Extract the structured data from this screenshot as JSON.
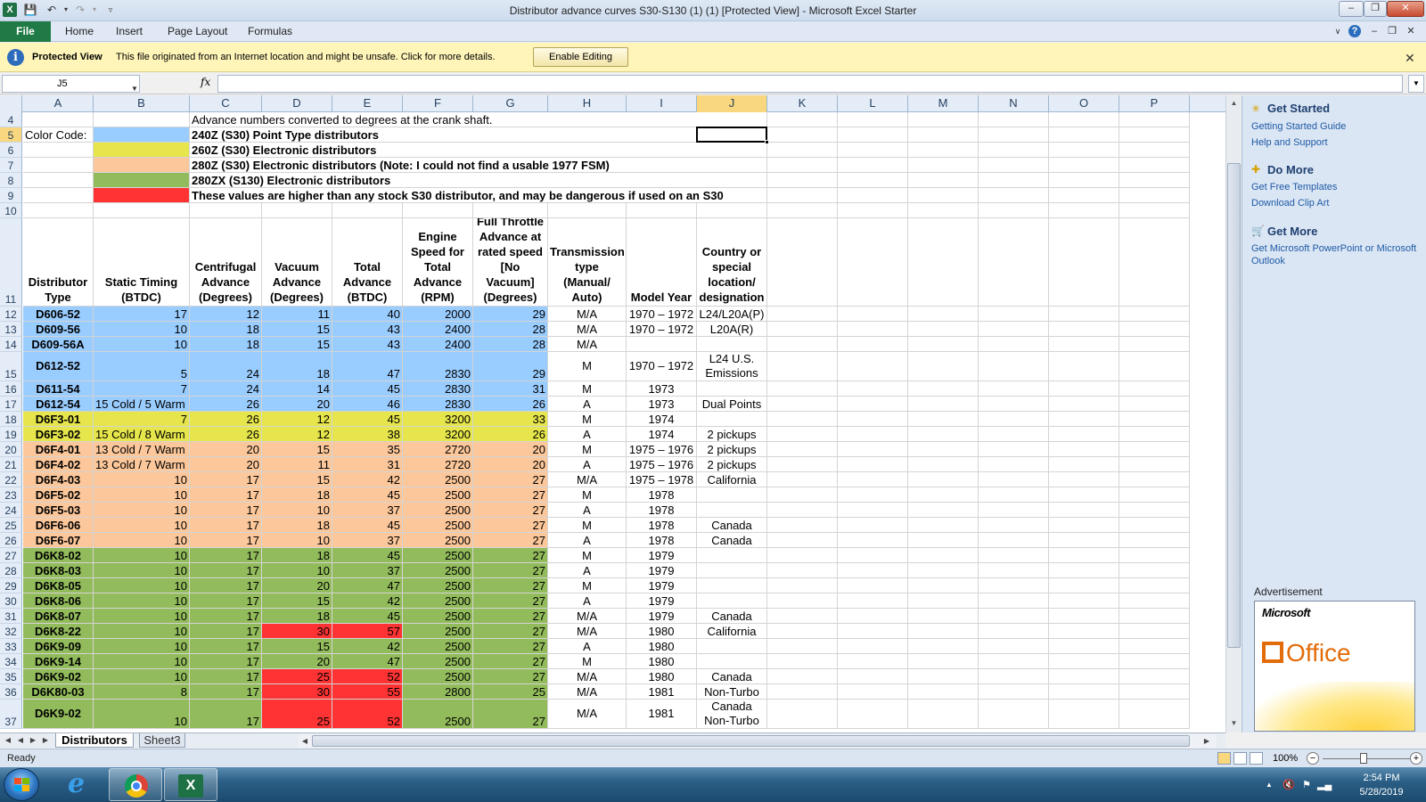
{
  "window": {
    "title": "Distributor advance curves S30-S130 (1) (1)  [Protected View]  -  Microsoft Excel Starter",
    "app_icon": "X",
    "controls": [
      "–",
      "❐",
      "✕"
    ]
  },
  "ribbon": {
    "file": "File",
    "tabs": [
      "Home",
      "Insert",
      "Page Layout",
      "Formulas"
    ]
  },
  "protected_view": {
    "title": "Protected View",
    "message": "This file originated from an Internet location and might be unsafe. Click for more details.",
    "button": "Enable Editing"
  },
  "formula_bar": {
    "name_box": "J5",
    "fx": "fx",
    "value": ""
  },
  "colors": {
    "blue": "#99ccff",
    "yellow": "#e6e64c",
    "peach": "#fcc79a",
    "green": "#92bc5b",
    "red": "#ff3333",
    "selection": "#f9d77e"
  },
  "columns": [
    "A",
    "B",
    "C",
    "D",
    "E",
    "F",
    "G",
    "H",
    "I",
    "J",
    "K",
    "L",
    "M",
    "N",
    "O",
    "P"
  ],
  "selected_cell": "J5",
  "legend": {
    "intro": "Advance numbers converted to degrees at the crank shaft.",
    "label": "Color Code:",
    "items": [
      {
        "color": "blue",
        "text": "240Z (S30) Point Type distributors"
      },
      {
        "color": "yellow",
        "text": "260Z (S30) Electronic distributors"
      },
      {
        "color": "peach",
        "text": "280Z (S30) Electronic distributors (Note: I could not find a usable 1977 FSM)"
      },
      {
        "color": "green",
        "text": "280ZX (S130) Electronic distributors"
      },
      {
        "color": "red",
        "text": "These values are higher than any stock S30 distributor, and may be dangerous if used on an  S30"
      }
    ]
  },
  "table": {
    "headers": [
      "Distributor Type",
      "Static Timing (BTDC)",
      "Centrifugal Advance (Degrees)",
      "Vacuum Advance (Degrees)",
      "Total Advance (BTDC)",
      "Engine Speed for Total Advance (RPM)",
      "Full Throttle Advance at rated speed [No Vacuum](Degrees)",
      "Transmission type (Manual/ Auto)",
      "Model Year",
      "Country or special location/ designation"
    ],
    "rows": [
      {
        "row": "12",
        "color": "blue",
        "cells": [
          "D606-52",
          "17",
          "12",
          "11",
          "40",
          "2000",
          "29",
          "M/A",
          "1970 – 1972",
          "L24/L20A(P)"
        ]
      },
      {
        "row": "13",
        "color": "blue",
        "cells": [
          "D609-56",
          "10",
          "18",
          "15",
          "43",
          "2400",
          "28",
          "M/A",
          "1970 – 1972",
          "L20A(R)"
        ]
      },
      {
        "row": "14",
        "color": "blue",
        "cells": [
          "D609-56A",
          "10",
          "18",
          "15",
          "43",
          "2400",
          "28",
          "M/A",
          "",
          ""
        ]
      },
      {
        "row": "15",
        "color": "blue",
        "cells": [
          "D612-52",
          "5",
          "24",
          "18",
          "47",
          "2830",
          "29",
          "M",
          "1970 – 1972",
          "L24 U.S. Emissions"
        ]
      },
      {
        "row": "16",
        "color": "blue",
        "cells": [
          "D611-54",
          "7",
          "24",
          "14",
          "45",
          "2830",
          "31",
          "M",
          "1973",
          ""
        ]
      },
      {
        "row": "17",
        "color": "blue",
        "cells": [
          "D612-54",
          "15 Cold / 5 Warm",
          "26",
          "20",
          "46",
          "2830",
          "26",
          "A",
          "1973",
          "Dual Points"
        ]
      },
      {
        "row": "18",
        "color": "yellow",
        "cells": [
          "D6F3-01",
          "7",
          "26",
          "12",
          "45",
          "3200",
          "33",
          "M",
          "1974",
          ""
        ]
      },
      {
        "row": "19",
        "color": "yellow",
        "cells": [
          "D6F3-02",
          "15 Cold / 8 Warm",
          "26",
          "12",
          "38",
          "3200",
          "26",
          "A",
          "1974",
          "2 pickups"
        ]
      },
      {
        "row": "20",
        "color": "peach",
        "cells": [
          "D6F4-01",
          "13 Cold / 7 Warm",
          "20",
          "15",
          "35",
          "2720",
          "20",
          "M",
          "1975 – 1976",
          "2 pickups"
        ]
      },
      {
        "row": "21",
        "color": "peach",
        "cells": [
          "D6F4-02",
          "13 Cold / 7 Warm",
          "20",
          "11",
          "31",
          "2720",
          "20",
          "A",
          "1975 – 1976",
          "2 pickups"
        ]
      },
      {
        "row": "22",
        "color": "peach",
        "cells": [
          "D6F4-03",
          "10",
          "17",
          "15",
          "42",
          "2500",
          "27",
          "M/A",
          "1975 – 1978",
          "California"
        ]
      },
      {
        "row": "23",
        "color": "peach",
        "cells": [
          "D6F5-02",
          "10",
          "17",
          "18",
          "45",
          "2500",
          "27",
          "M",
          "1978",
          ""
        ]
      },
      {
        "row": "24",
        "color": "peach",
        "cells": [
          "D6F5-03",
          "10",
          "17",
          "10",
          "37",
          "2500",
          "27",
          "A",
          "1978",
          ""
        ]
      },
      {
        "row": "25",
        "color": "peach",
        "cells": [
          "D6F6-06",
          "10",
          "17",
          "18",
          "45",
          "2500",
          "27",
          "M",
          "1978",
          "Canada"
        ]
      },
      {
        "row": "26",
        "color": "peach",
        "cells": [
          "D6F6-07",
          "10",
          "17",
          "10",
          "37",
          "2500",
          "27",
          "A",
          "1978",
          "Canada"
        ]
      },
      {
        "row": "27",
        "color": "green",
        "cells": [
          "D6K8-02",
          "10",
          "17",
          "18",
          "45",
          "2500",
          "27",
          "M",
          "1979",
          ""
        ]
      },
      {
        "row": "28",
        "color": "green",
        "cells": [
          "D6K8-03",
          "10",
          "17",
          "10",
          "37",
          "2500",
          "27",
          "A",
          "1979",
          ""
        ]
      },
      {
        "row": "29",
        "color": "green",
        "cells": [
          "D6K8-05",
          "10",
          "17",
          "20",
          "47",
          "2500",
          "27",
          "M",
          "1979",
          ""
        ]
      },
      {
        "row": "30",
        "color": "green",
        "cells": [
          "D6K8-06",
          "10",
          "17",
          "15",
          "42",
          "2500",
          "27",
          "A",
          "1979",
          ""
        ]
      },
      {
        "row": "31",
        "color": "green",
        "cells": [
          "D6K8-07",
          "10",
          "17",
          "18",
          "45",
          "2500",
          "27",
          "M/A",
          "1979",
          "Canada"
        ]
      },
      {
        "row": "32",
        "color": "green",
        "red": [
          3,
          4
        ],
        "cells": [
          "D6K8-22",
          "10",
          "17",
          "30",
          "57",
          "2500",
          "27",
          "M/A",
          "1980",
          "California"
        ]
      },
      {
        "row": "33",
        "color": "green",
        "cells": [
          "D6K9-09",
          "10",
          "17",
          "15",
          "42",
          "2500",
          "27",
          "A",
          "1980",
          ""
        ]
      },
      {
        "row": "34",
        "color": "green",
        "cells": [
          "D6K9-14",
          "10",
          "17",
          "20",
          "47",
          "2500",
          "27",
          "M",
          "1980",
          ""
        ]
      },
      {
        "row": "35",
        "color": "green",
        "red": [
          3,
          4
        ],
        "cells": [
          "D6K9-02",
          "10",
          "17",
          "25",
          "52",
          "2500",
          "27",
          "M/A",
          "1980",
          "Canada"
        ]
      },
      {
        "row": "36",
        "color": "green",
        "red": [
          3,
          4
        ],
        "cells": [
          "D6K80-03",
          "8",
          "17",
          "30",
          "55",
          "2800",
          "25",
          "M/A",
          "1981",
          "Non-Turbo"
        ]
      },
      {
        "row": "37",
        "color": "green",
        "red": [
          3,
          4
        ],
        "cells": [
          "D6K9-02",
          "10",
          "17",
          "25",
          "52",
          "2500",
          "27",
          "M/A",
          "1981",
          "Canada  Non-Turbo"
        ]
      }
    ]
  },
  "task_pane": {
    "sections": [
      {
        "title": "Get Started",
        "icon": "sparkle-icon",
        "links": [
          "Getting Started Guide",
          "Help and Support"
        ]
      },
      {
        "title": "Do More",
        "icon": "plus-icon",
        "links": [
          "Get Free Templates",
          "Download Clip Art"
        ]
      },
      {
        "title": "Get More",
        "icon": "cart-icon",
        "links": [
          "Get Microsoft PowerPoint or Microsoft Outlook"
        ]
      }
    ],
    "ad_label": "Advertisement",
    "ad_brand": "Microsoft",
    "ad_product": "Office"
  },
  "sheets": {
    "tabs": [
      "Distributors",
      "Sheet3"
    ],
    "active": "Distributors"
  },
  "status": {
    "ready": "Ready",
    "zoom": "100%"
  },
  "taskbar": {
    "time": "2:54 PM",
    "date": "5/28/2019"
  }
}
